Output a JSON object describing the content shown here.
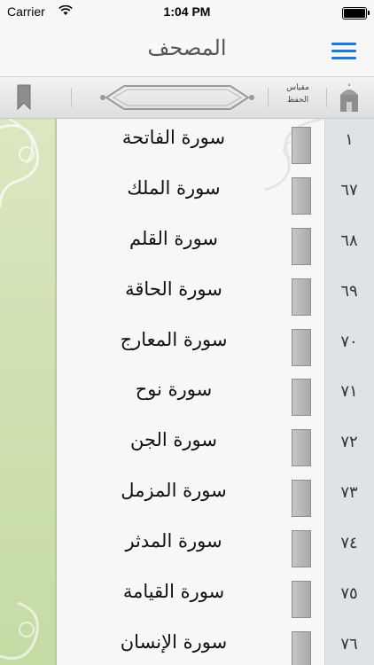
{
  "status_bar": {
    "carrier": "Carrier",
    "time": "1:04 PM"
  },
  "nav": {
    "title": "المصحف",
    "menu_icon": "hamburger-icon",
    "accent_color": "#1f7adf"
  },
  "toolbar": {
    "memorize_label_line1": "مقياس",
    "memorize_label_line2": "الحفظ",
    "bookmark_icon": "bookmark-icon",
    "mosque_icon": "mosque-icon"
  },
  "surahs": [
    {
      "name": "سورة الفاتحة",
      "number": "١"
    },
    {
      "name": "سورة الملك",
      "number": "٦٧"
    },
    {
      "name": "سورة القلم",
      "number": "٦٨"
    },
    {
      "name": "سورة الحاقة",
      "number": "٦٩"
    },
    {
      "name": "سورة المعارج",
      "number": "٧٠"
    },
    {
      "name": "سورة نوح",
      "number": "٧١"
    },
    {
      "name": "سورة الجن",
      "number": "٧٢"
    },
    {
      "name": "سورة المزمل",
      "number": "٧٣"
    },
    {
      "name": "سورة المدثر",
      "number": "٧٤"
    },
    {
      "name": "سورة القيامة",
      "number": "٧٥"
    },
    {
      "name": "سورة الإنسان",
      "number": "٧٦"
    }
  ]
}
